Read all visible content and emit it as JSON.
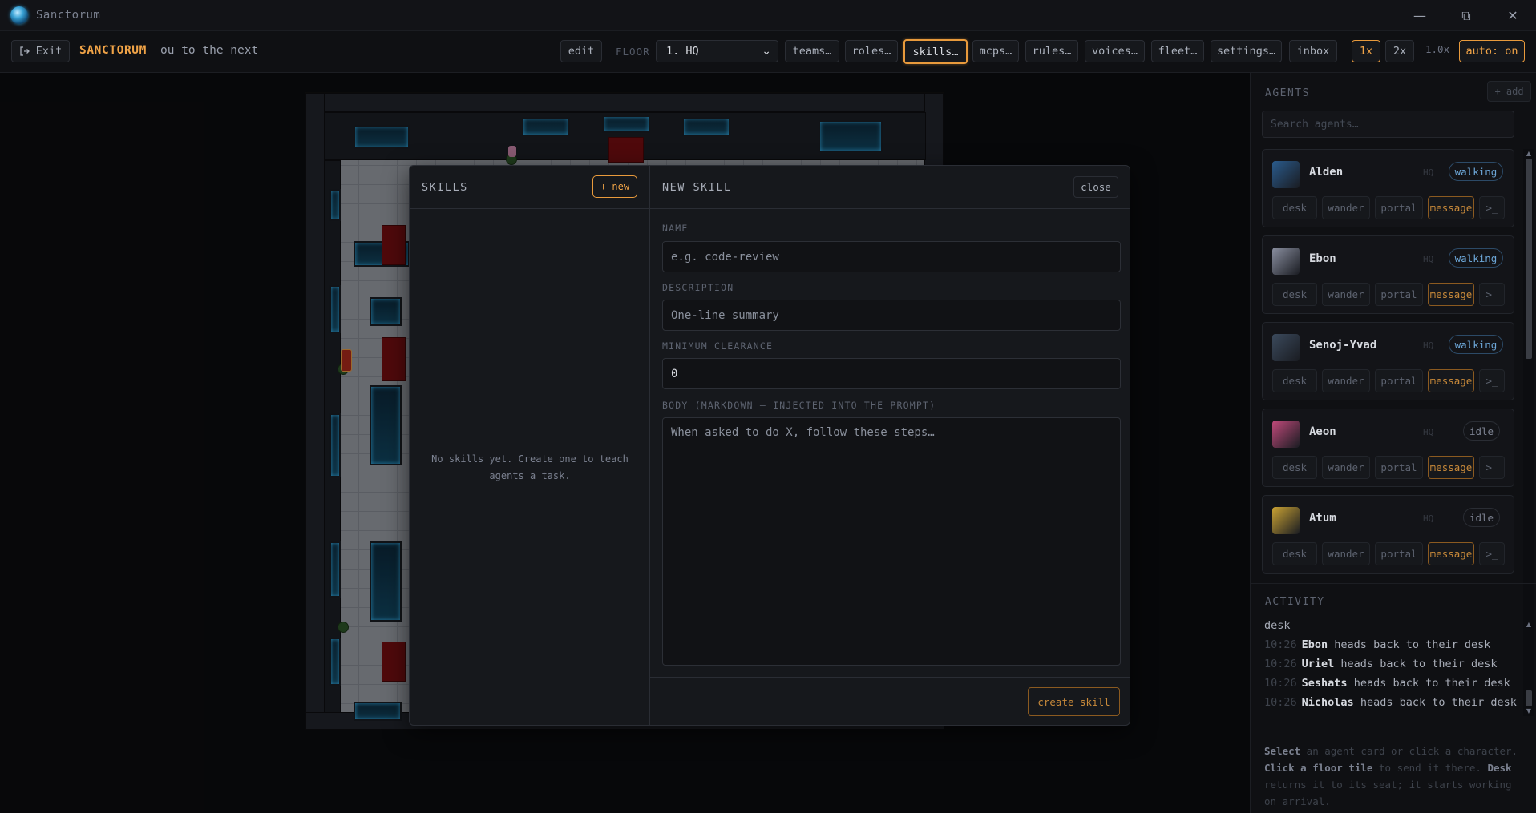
{
  "window": {
    "title": "Sanctorum",
    "controls": {
      "minimize": "—",
      "restore": "⧉",
      "close": "✕"
    }
  },
  "toolbar": {
    "exit_label": "Exit",
    "brand": "SANCTORUM",
    "marquee": "ou to the next",
    "edit_label": "edit",
    "floor_label": "FLOOR",
    "floor_value": "1. HQ",
    "nav": {
      "teams": "teams…",
      "roles": "roles…",
      "skills": "skills…",
      "mcps": "mcps…",
      "rules": "rules…",
      "voices": "voices…",
      "fleet": "fleet…",
      "settings": "settings…",
      "inbox": "inbox"
    },
    "speed_1x": "1x",
    "speed_2x": "2x",
    "speed_readout": "1.0x",
    "auto_label": "auto: on"
  },
  "skills_modal": {
    "list_title": "SKILLS",
    "new_button": "+ new",
    "empty_message": "No skills yet. Create one to teach agents a task.",
    "form_title": "NEW SKILL",
    "close_button": "close",
    "name_label": "NAME",
    "name_placeholder": "e.g. code-review",
    "description_label": "DESCRIPTION",
    "description_placeholder": "One-line summary",
    "clearance_label": "MINIMUM CLEARANCE",
    "clearance_value": "0",
    "body_label": "BODY (MARKDOWN — INJECTED INTO THE PROMPT)",
    "body_placeholder": "When asked to do X, follow these steps…",
    "create_button": "create skill"
  },
  "sidebar": {
    "agents_title": "AGENTS",
    "add_button": "+ add",
    "search_placeholder": "Search agents…",
    "action_labels": {
      "desk": "desk",
      "wander": "wander",
      "portal": "portal",
      "message": "message",
      "terminal": ">_"
    },
    "agents": [
      {
        "name": "Alden",
        "location": "HQ",
        "status": "walking",
        "avatar_color": "#2a5b8c"
      },
      {
        "name": "Ebon",
        "location": "HQ",
        "status": "walking",
        "avatar_color": "#8a8fa0"
      },
      {
        "name": "Senoj-Yvad",
        "location": "HQ",
        "status": "walking",
        "avatar_color": "#3b4a5c"
      },
      {
        "name": "Aeon",
        "location": "HQ",
        "status": "idle",
        "avatar_color": "#c04a7a"
      },
      {
        "name": "Atum",
        "location": "HQ",
        "status": "idle",
        "avatar_color": "#c9a233"
      }
    ],
    "activity_title": "ACTIVITY",
    "activity": [
      {
        "time": "",
        "who": "",
        "text": "desk"
      },
      {
        "time": "10:26",
        "who": "Ebon",
        "text": "heads back to their desk"
      },
      {
        "time": "10:26",
        "who": "Uriel",
        "text": "heads back to their desk"
      },
      {
        "time": "10:26",
        "who": "Seshats",
        "text": "heads back to their desk"
      },
      {
        "time": "10:26",
        "who": "Nicholas",
        "text": "heads back to their desk"
      }
    ],
    "help": {
      "p1": "Select",
      "p2": " an agent card or click a character.",
      "p3": "Click a floor tile",
      "p4": " to send it there. ",
      "p5": "Desk",
      "p6": " returns it to its seat; it starts working on arrival."
    }
  },
  "colors": {
    "accent": "#f0a347",
    "walking": "#6da7d8",
    "background": "#0c0d10"
  }
}
